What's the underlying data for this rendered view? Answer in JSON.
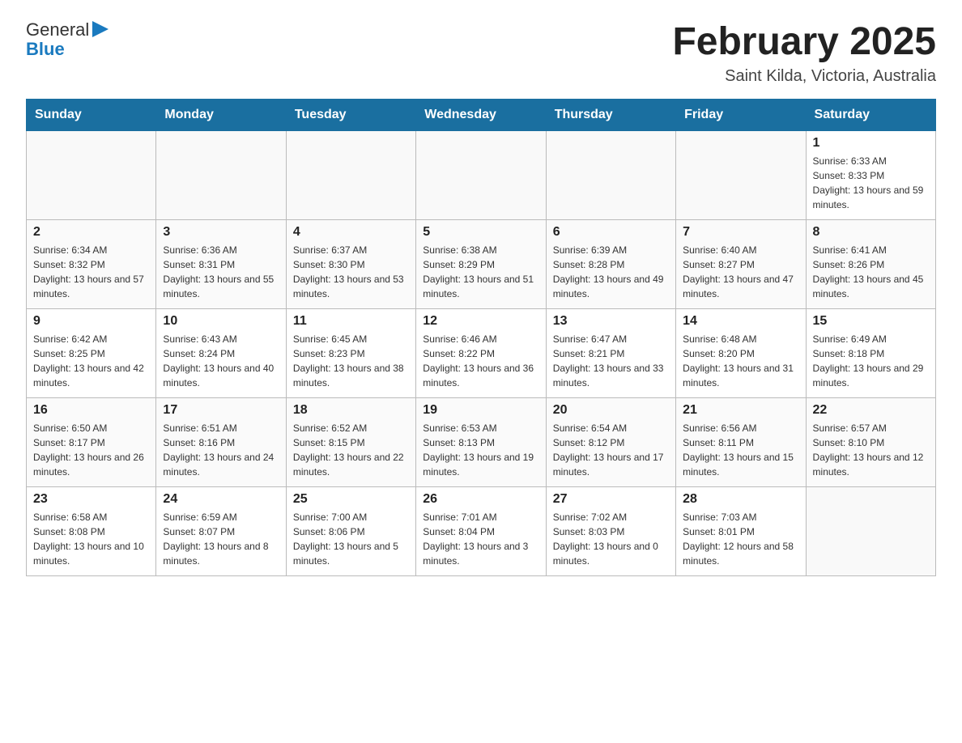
{
  "header": {
    "logo_text_general": "General",
    "logo_text_blue": "Blue",
    "title": "February 2025",
    "subtitle": "Saint Kilda, Victoria, Australia"
  },
  "days_of_week": [
    "Sunday",
    "Monday",
    "Tuesday",
    "Wednesday",
    "Thursday",
    "Friday",
    "Saturday"
  ],
  "weeks": [
    [
      {
        "day": "",
        "sunrise": "",
        "sunset": "",
        "daylight": ""
      },
      {
        "day": "",
        "sunrise": "",
        "sunset": "",
        "daylight": ""
      },
      {
        "day": "",
        "sunrise": "",
        "sunset": "",
        "daylight": ""
      },
      {
        "day": "",
        "sunrise": "",
        "sunset": "",
        "daylight": ""
      },
      {
        "day": "",
        "sunrise": "",
        "sunset": "",
        "daylight": ""
      },
      {
        "day": "",
        "sunrise": "",
        "sunset": "",
        "daylight": ""
      },
      {
        "day": "1",
        "sunrise": "Sunrise: 6:33 AM",
        "sunset": "Sunset: 8:33 PM",
        "daylight": "Daylight: 13 hours and 59 minutes."
      }
    ],
    [
      {
        "day": "2",
        "sunrise": "Sunrise: 6:34 AM",
        "sunset": "Sunset: 8:32 PM",
        "daylight": "Daylight: 13 hours and 57 minutes."
      },
      {
        "day": "3",
        "sunrise": "Sunrise: 6:36 AM",
        "sunset": "Sunset: 8:31 PM",
        "daylight": "Daylight: 13 hours and 55 minutes."
      },
      {
        "day": "4",
        "sunrise": "Sunrise: 6:37 AM",
        "sunset": "Sunset: 8:30 PM",
        "daylight": "Daylight: 13 hours and 53 minutes."
      },
      {
        "day": "5",
        "sunrise": "Sunrise: 6:38 AM",
        "sunset": "Sunset: 8:29 PM",
        "daylight": "Daylight: 13 hours and 51 minutes."
      },
      {
        "day": "6",
        "sunrise": "Sunrise: 6:39 AM",
        "sunset": "Sunset: 8:28 PM",
        "daylight": "Daylight: 13 hours and 49 minutes."
      },
      {
        "day": "7",
        "sunrise": "Sunrise: 6:40 AM",
        "sunset": "Sunset: 8:27 PM",
        "daylight": "Daylight: 13 hours and 47 minutes."
      },
      {
        "day": "8",
        "sunrise": "Sunrise: 6:41 AM",
        "sunset": "Sunset: 8:26 PM",
        "daylight": "Daylight: 13 hours and 45 minutes."
      }
    ],
    [
      {
        "day": "9",
        "sunrise": "Sunrise: 6:42 AM",
        "sunset": "Sunset: 8:25 PM",
        "daylight": "Daylight: 13 hours and 42 minutes."
      },
      {
        "day": "10",
        "sunrise": "Sunrise: 6:43 AM",
        "sunset": "Sunset: 8:24 PM",
        "daylight": "Daylight: 13 hours and 40 minutes."
      },
      {
        "day": "11",
        "sunrise": "Sunrise: 6:45 AM",
        "sunset": "Sunset: 8:23 PM",
        "daylight": "Daylight: 13 hours and 38 minutes."
      },
      {
        "day": "12",
        "sunrise": "Sunrise: 6:46 AM",
        "sunset": "Sunset: 8:22 PM",
        "daylight": "Daylight: 13 hours and 36 minutes."
      },
      {
        "day": "13",
        "sunrise": "Sunrise: 6:47 AM",
        "sunset": "Sunset: 8:21 PM",
        "daylight": "Daylight: 13 hours and 33 minutes."
      },
      {
        "day": "14",
        "sunrise": "Sunrise: 6:48 AM",
        "sunset": "Sunset: 8:20 PM",
        "daylight": "Daylight: 13 hours and 31 minutes."
      },
      {
        "day": "15",
        "sunrise": "Sunrise: 6:49 AM",
        "sunset": "Sunset: 8:18 PM",
        "daylight": "Daylight: 13 hours and 29 minutes."
      }
    ],
    [
      {
        "day": "16",
        "sunrise": "Sunrise: 6:50 AM",
        "sunset": "Sunset: 8:17 PM",
        "daylight": "Daylight: 13 hours and 26 minutes."
      },
      {
        "day": "17",
        "sunrise": "Sunrise: 6:51 AM",
        "sunset": "Sunset: 8:16 PM",
        "daylight": "Daylight: 13 hours and 24 minutes."
      },
      {
        "day": "18",
        "sunrise": "Sunrise: 6:52 AM",
        "sunset": "Sunset: 8:15 PM",
        "daylight": "Daylight: 13 hours and 22 minutes."
      },
      {
        "day": "19",
        "sunrise": "Sunrise: 6:53 AM",
        "sunset": "Sunset: 8:13 PM",
        "daylight": "Daylight: 13 hours and 19 minutes."
      },
      {
        "day": "20",
        "sunrise": "Sunrise: 6:54 AM",
        "sunset": "Sunset: 8:12 PM",
        "daylight": "Daylight: 13 hours and 17 minutes."
      },
      {
        "day": "21",
        "sunrise": "Sunrise: 6:56 AM",
        "sunset": "Sunset: 8:11 PM",
        "daylight": "Daylight: 13 hours and 15 minutes."
      },
      {
        "day": "22",
        "sunrise": "Sunrise: 6:57 AM",
        "sunset": "Sunset: 8:10 PM",
        "daylight": "Daylight: 13 hours and 12 minutes."
      }
    ],
    [
      {
        "day": "23",
        "sunrise": "Sunrise: 6:58 AM",
        "sunset": "Sunset: 8:08 PM",
        "daylight": "Daylight: 13 hours and 10 minutes."
      },
      {
        "day": "24",
        "sunrise": "Sunrise: 6:59 AM",
        "sunset": "Sunset: 8:07 PM",
        "daylight": "Daylight: 13 hours and 8 minutes."
      },
      {
        "day": "25",
        "sunrise": "Sunrise: 7:00 AM",
        "sunset": "Sunset: 8:06 PM",
        "daylight": "Daylight: 13 hours and 5 minutes."
      },
      {
        "day": "26",
        "sunrise": "Sunrise: 7:01 AM",
        "sunset": "Sunset: 8:04 PM",
        "daylight": "Daylight: 13 hours and 3 minutes."
      },
      {
        "day": "27",
        "sunrise": "Sunrise: 7:02 AM",
        "sunset": "Sunset: 8:03 PM",
        "daylight": "Daylight: 13 hours and 0 minutes."
      },
      {
        "day": "28",
        "sunrise": "Sunrise: 7:03 AM",
        "sunset": "Sunset: 8:01 PM",
        "daylight": "Daylight: 12 hours and 58 minutes."
      },
      {
        "day": "",
        "sunrise": "",
        "sunset": "",
        "daylight": ""
      }
    ]
  ]
}
